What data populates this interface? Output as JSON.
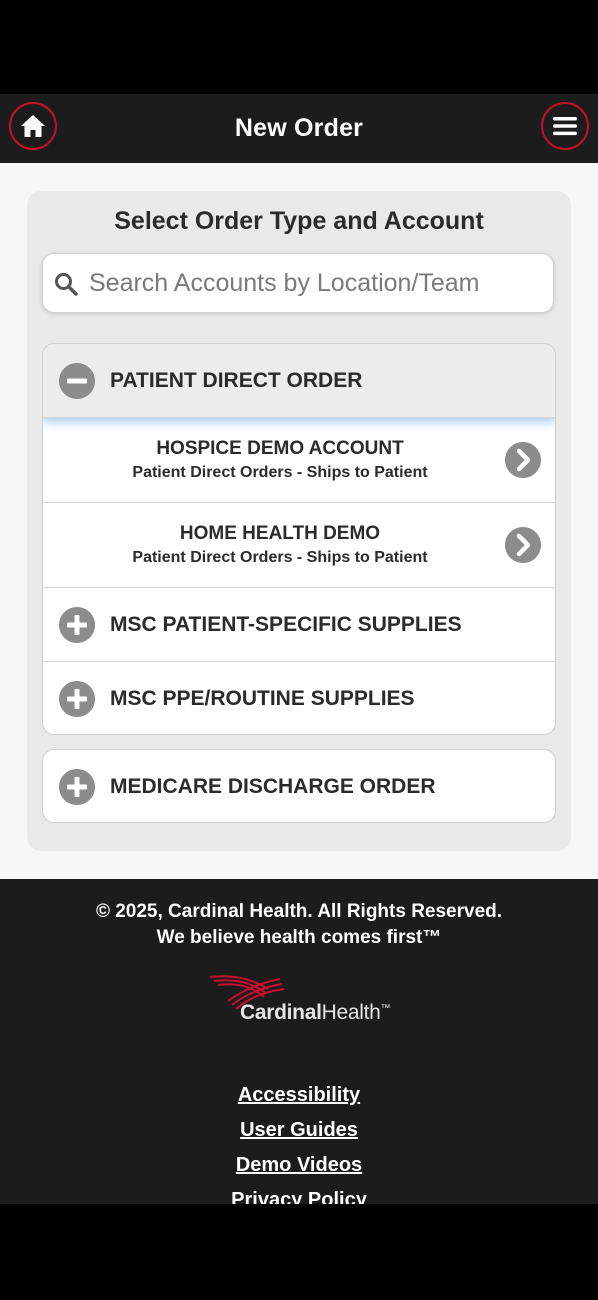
{
  "header": {
    "title": "New Order",
    "home_icon": "home-icon",
    "menu_icon": "hamburger-menu-icon",
    "accent": "#c8102e"
  },
  "panel": {
    "title": "Select Order Type and Account",
    "search": {
      "placeholder": "Search Accounts by Location/Team",
      "value": ""
    }
  },
  "groups": [
    {
      "label": "PATIENT DIRECT ORDER",
      "expanded": true,
      "items": [
        {
          "name": "HOSPICE DEMO ACCOUNT",
          "sub": "Patient Direct Orders - Ships to Patient"
        },
        {
          "name": "HOME HEALTH DEMO",
          "sub": "Patient Direct Orders - Ships to Patient"
        }
      ]
    },
    {
      "label": "MSC PATIENT-SPECIFIC SUPPLIES",
      "expanded": false
    },
    {
      "label": "MSC PPE/ROUTINE SUPPLIES",
      "expanded": false
    },
    {
      "label": "MEDICARE DISCHARGE ORDER",
      "expanded": false
    }
  ],
  "footer": {
    "copyright": "© 2025, Cardinal Health. All Rights Reserved.",
    "tagline": "We believe health comes first™",
    "logo_text_bold": "Cardinal",
    "logo_text": "Health",
    "logo_tm": "™",
    "links": [
      "Accessibility",
      "User Guides",
      "Demo Videos",
      "Privacy Policy"
    ]
  }
}
